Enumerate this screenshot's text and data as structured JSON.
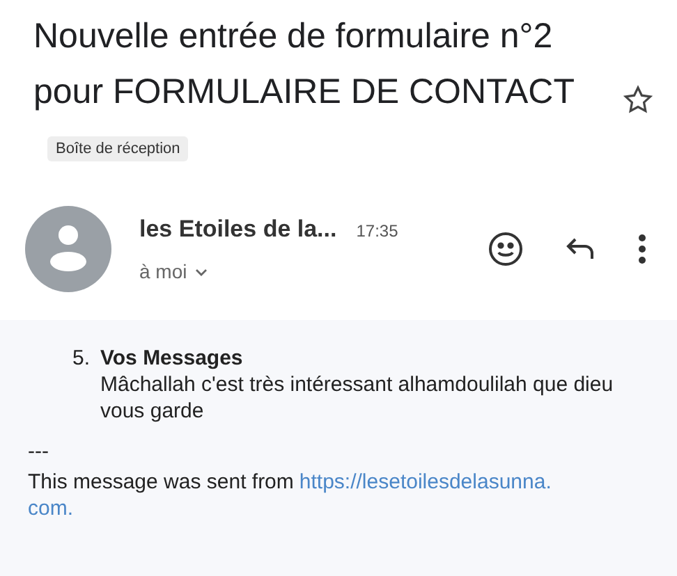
{
  "subject": {
    "title": "Nouvelle entrée de formulaire n°2 pour FORMULAIRE DE CONTACT",
    "label": "Boîte de réception",
    "starred": false
  },
  "sender": {
    "name": "les Etoiles de la...",
    "time": "17:35",
    "recipient": "à moi"
  },
  "body": {
    "items": [
      {
        "number": "5.",
        "heading": "Vos Messages",
        "text": "Mâchallah c'est très intéressant alhamdoulilah que dieu vous garde"
      }
    ],
    "separator": "---",
    "footer_text": "This message was sent from",
    "link_lines": [
      "https://lesetoilesdelasunna.",
      "com."
    ]
  }
}
